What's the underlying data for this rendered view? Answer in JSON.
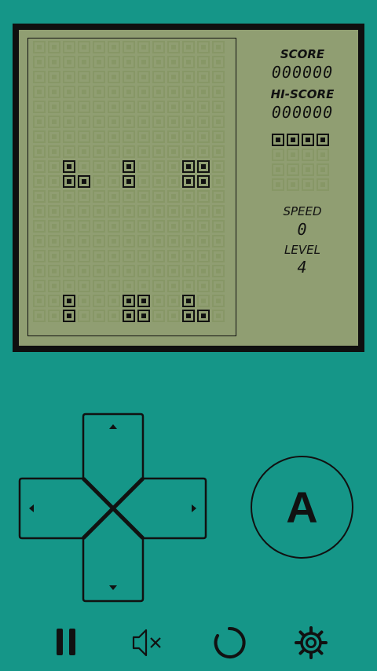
{
  "hud": {
    "score_label": "SCORE",
    "score_value": "000000",
    "hiscore_label": "HI-SCORE",
    "hiscore_value": "000000",
    "speed_label": "SPEED",
    "speed_value": "0",
    "level_label": "LEVEL",
    "level_value": "4"
  },
  "controls": {
    "action_button_label": "A",
    "icons": [
      "pause-icon",
      "mute-icon",
      "restart-icon",
      "settings-icon"
    ]
  },
  "colors": {
    "background": "#159688",
    "lcd": "#909e72",
    "pixel_on": "#111111",
    "pixel_off": "#879766"
  }
}
